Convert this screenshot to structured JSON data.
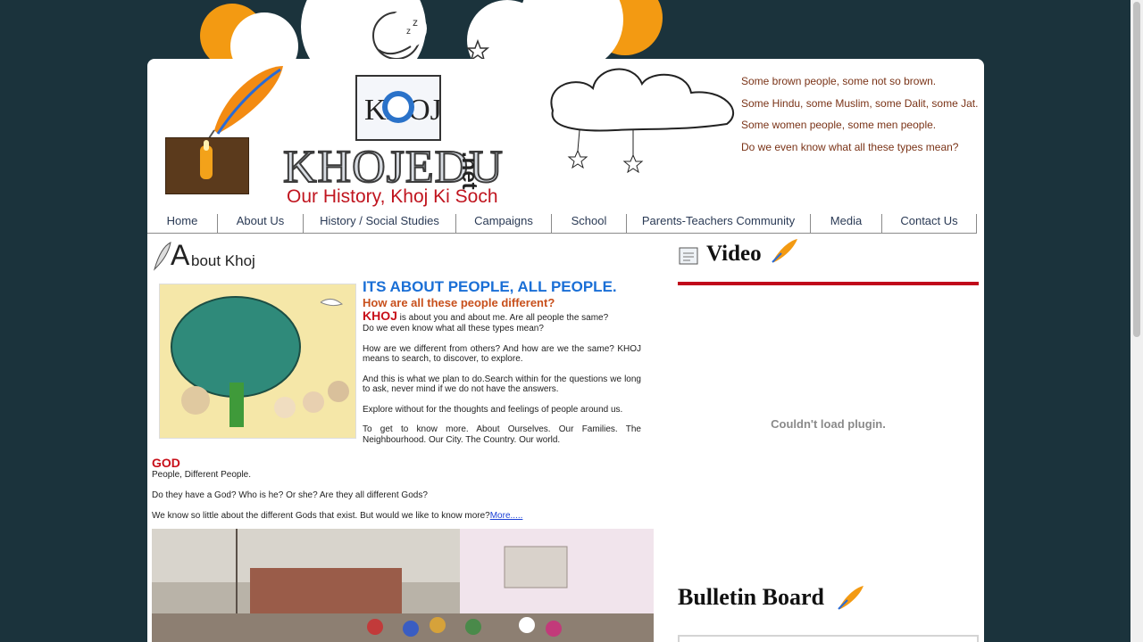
{
  "logo": {
    "name": "KHOJEDU",
    "domain": ".net",
    "tagline": "Our History, Khoj Ki Soch",
    "mark": "KHOJ"
  },
  "header_quotes": [
    "Some brown people, some not so brown.",
    "Some Hindu, some Muslim, some Dalit, some Jat.",
    "Some women people, some men people.",
    "Do we even know what all these types mean?"
  ],
  "nav": [
    {
      "label": "Home"
    },
    {
      "label": "About Us"
    },
    {
      "label": "History / Social Studies"
    },
    {
      "label": "Campaigns"
    },
    {
      "label": "School"
    },
    {
      "label": "Parents-Teachers Community"
    },
    {
      "label": "Media"
    },
    {
      "label": "Contact Us"
    }
  ],
  "about": {
    "heading_initial": "A",
    "heading_rest": "bout Khoj",
    "title": "ITS ABOUT PEOPLE, ALL PEOPLE.",
    "subtitle": "How are all these people different?",
    "khoj_word": "KHOJ",
    "khoj_rest": " is about you and about me. Are all people the same?",
    "line2": "Do we even know what all these types mean?",
    "paragraphs": [
      "How are we different from others? And how are we the same? KHOJ means to search, to discover, to explore.",
      "And this is what we plan to do.Search within for the questions we long to ask, never mind if we do not have the answers.",
      "Explore without for the thoughts and feelings of people around us.",
      "To get to know more. About Ourselves. Our Families. The Neighbourhood. Our City. The Country. Our world."
    ]
  },
  "god": {
    "heading": "GOD",
    "line1": "People, Different People.",
    "line2": "Do they have a God? Who is he? Or she? Are they all different Gods?",
    "line3": "We know so little about the different Gods that exist. But would we like to know more?",
    "more_link": "More....."
  },
  "video": {
    "title": "Video",
    "plugin_message": "Couldn't load plugin."
  },
  "bulletin": {
    "title": "Bulletin Board"
  },
  "colors": {
    "background": "#1b333c",
    "nav_text": "#2a3a55",
    "accent_red": "#c0081a",
    "title_blue": "#1a6fd6",
    "quote_brown": "#7a3317"
  },
  "icons": [
    "moon-icon",
    "star-icon",
    "quill-pen-icon",
    "candle-lamp-icon",
    "notepad-icon",
    "cloud-drawing-icon"
  ]
}
